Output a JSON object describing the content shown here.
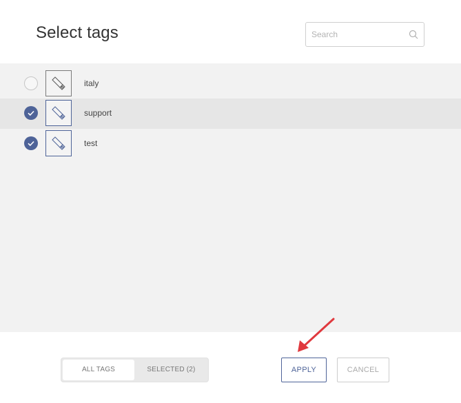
{
  "header": {
    "title": "Select tags",
    "search": {
      "placeholder": "Search",
      "value": ""
    }
  },
  "tags": [
    {
      "label": "italy",
      "checked": false
    },
    {
      "label": "support",
      "checked": true
    },
    {
      "label": "test",
      "checked": true
    }
  ],
  "footer": {
    "filter_all_label": "ALL TAGS",
    "filter_selected_label": "SELECTED (2)",
    "apply_label": "APPLY",
    "cancel_label": "CANCEL"
  },
  "colors": {
    "accent": "#4e6398",
    "list_background": "#f2f2f2",
    "annotation_arrow": "#e0393e"
  },
  "icons": {
    "search": "search-icon",
    "tag": "tag-icon",
    "check": "checkmark-icon"
  }
}
